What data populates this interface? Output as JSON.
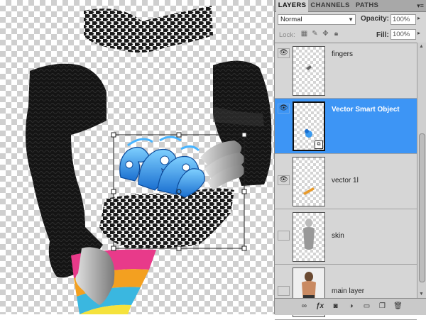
{
  "tabs": [
    "LAYERS",
    "CHANNELS",
    "PATHS"
  ],
  "blend_mode": "Normal",
  "opacity": {
    "label": "Opacity:",
    "value": "100%"
  },
  "lock": {
    "label": "Lock:"
  },
  "fill": {
    "label": "Fill:",
    "value": "100%"
  },
  "layers": [
    {
      "name": "fingers",
      "visible": true,
      "selected": false
    },
    {
      "name": "Vector Smart Object",
      "visible": true,
      "selected": true,
      "smart_object": true
    },
    {
      "name": "vector 1l",
      "visible": true,
      "selected": false
    },
    {
      "name": "skin",
      "visible": false,
      "selected": false
    },
    {
      "name": "main layer",
      "visible": false,
      "selected": false
    }
  ],
  "icons": {
    "visibility": "eye-icon",
    "lock": [
      "lock-transparent-icon",
      "lock-image-icon",
      "lock-position-icon",
      "lock-all-icon"
    ],
    "bottom_bar": [
      "link-layers-icon",
      "fx-icon",
      "layer-mask-icon",
      "adjustment-layer-icon",
      "new-group-icon",
      "new-layer-icon",
      "trash-icon"
    ]
  },
  "colors": {
    "selection": "#3d95f5",
    "panel": "#d6d6d6"
  }
}
